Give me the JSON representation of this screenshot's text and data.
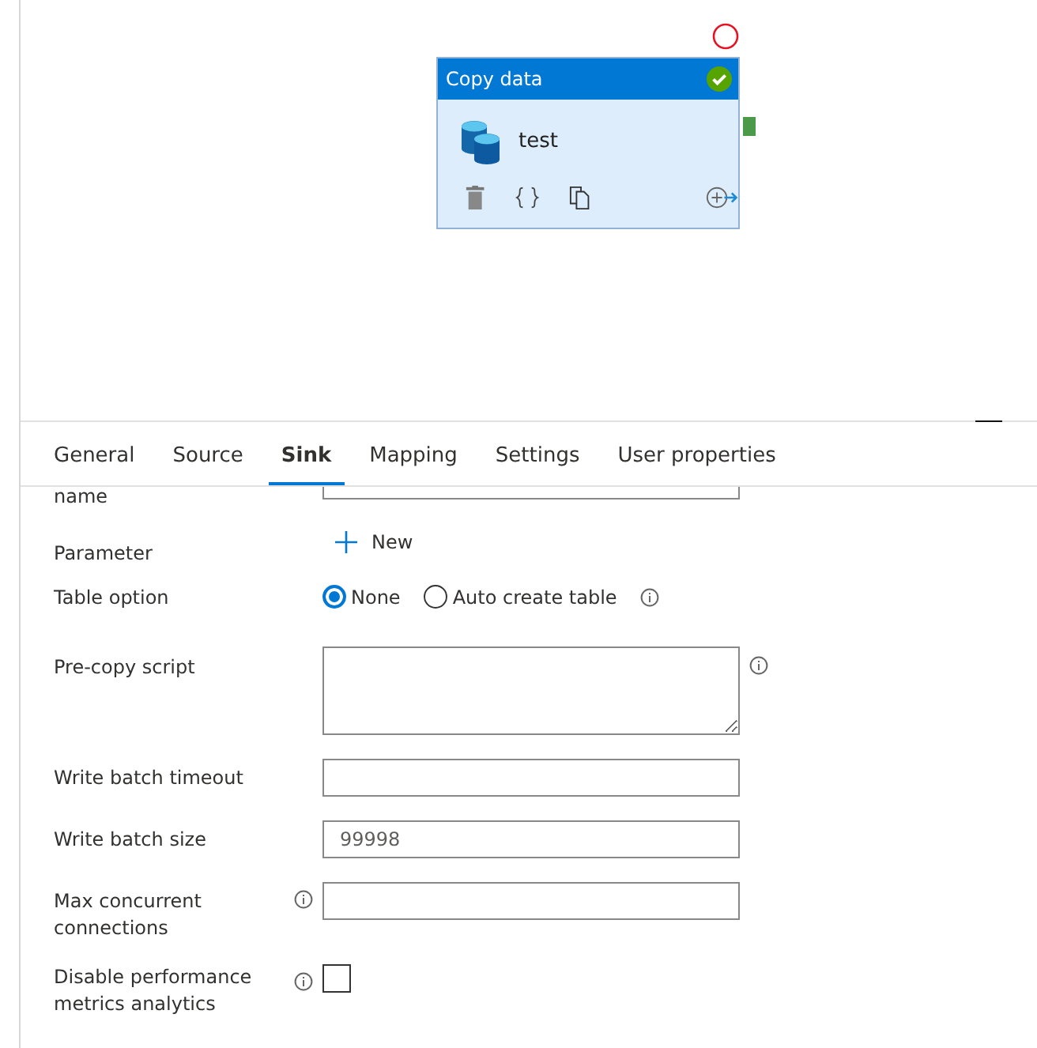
{
  "canvas": {
    "activity": {
      "header": "Copy data",
      "name": "test",
      "succeeded": true
    }
  },
  "tabs": [
    {
      "label": "General",
      "selected": false
    },
    {
      "label": "Source",
      "selected": false
    },
    {
      "label": "Sink",
      "selected": true
    },
    {
      "label": "Mapping",
      "selected": false
    },
    {
      "label": "Settings",
      "selected": false
    },
    {
      "label": "User properties",
      "selected": false
    }
  ],
  "form": [
    {
      "kind": "cut",
      "label": "name"
    },
    {
      "kind": "new",
      "label": "Parameter",
      "button": "New"
    },
    {
      "kind": "radio",
      "label": "Table option",
      "options": [
        {
          "label": "None",
          "selected": true,
          "info": false
        },
        {
          "label": "Auto create table",
          "selected": false,
          "info": true
        }
      ]
    },
    {
      "kind": "textarea",
      "label": "Pre-copy script",
      "info": true
    },
    {
      "kind": "text",
      "label": "Write batch timeout",
      "info": false
    },
    {
      "kind": "text",
      "label": "Write batch size",
      "info": false,
      "placeholder": "99998"
    },
    {
      "kind": "text",
      "label": "Max concurrent connections",
      "info": true
    },
    {
      "kind": "checkbox",
      "label": "Disable performance metrics analytics",
      "info": true,
      "checked": false
    }
  ]
}
